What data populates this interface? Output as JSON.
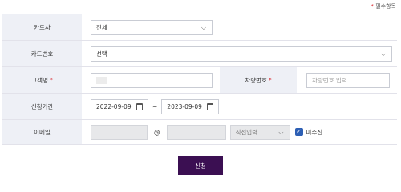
{
  "required_note": {
    "star": "*",
    "text": "필수항목"
  },
  "form": {
    "card_company": {
      "label": "카드사",
      "value": "전체"
    },
    "card_number": {
      "label": "카드번호",
      "value": "선택"
    },
    "customer_name": {
      "label": "고객명",
      "required_mark": "*"
    },
    "vehicle_number": {
      "label": "차량번호",
      "required_mark": "*",
      "placeholder": "차량번호 입력"
    },
    "period": {
      "label": "신청기간",
      "start": "2022-09-09",
      "tilde": "~",
      "end": "2023-09-09"
    },
    "email": {
      "label": "이메일",
      "at": "@",
      "domain_select": "직접입력",
      "unreceived_label": "미수신",
      "unreceived_checked": true
    }
  },
  "submit_label": "신청"
}
